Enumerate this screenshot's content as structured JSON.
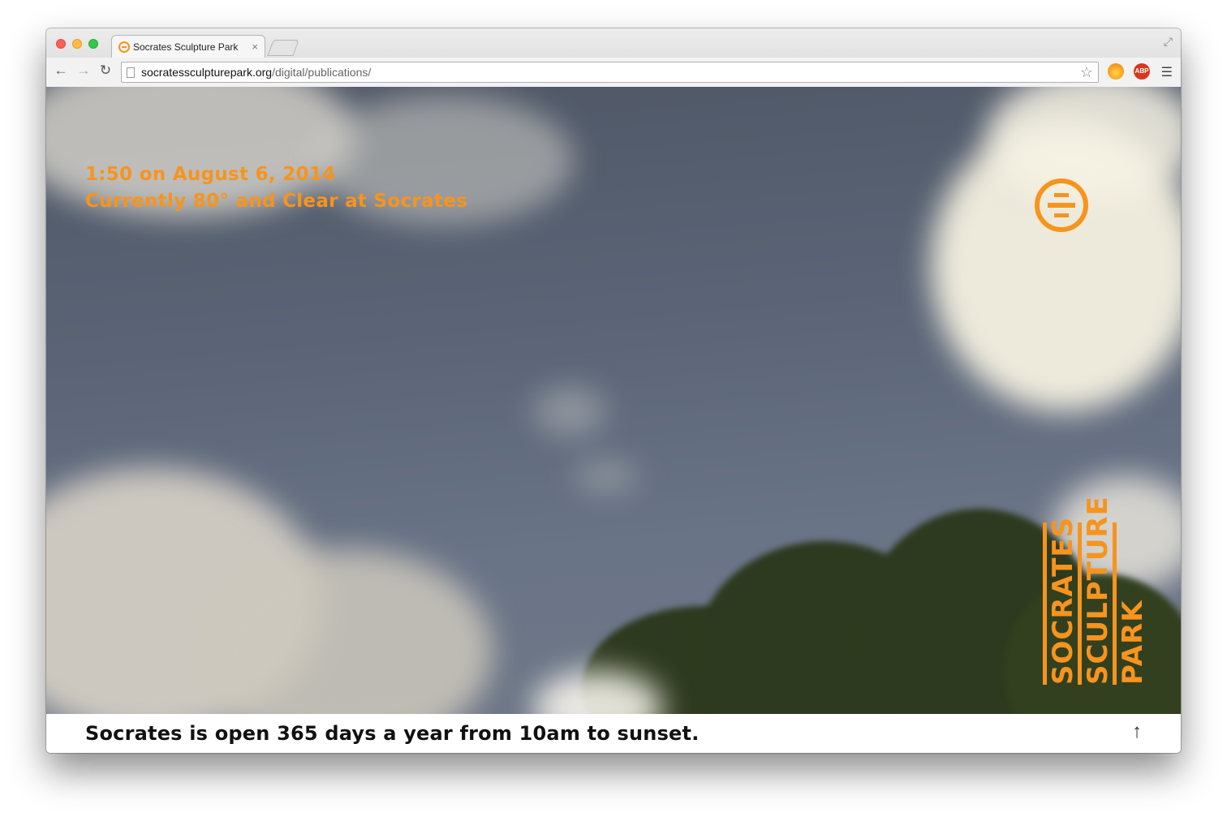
{
  "browser": {
    "tab_title": "Socrates Sculpture Park",
    "tab_close": "×",
    "url_host": "socratessculpturepark.org",
    "url_path": "/digital/publications/",
    "abp_label": "ABP"
  },
  "hero": {
    "time_line": "1:50 on August 6, 2014",
    "weather_line": "Currently 80° and Clear at Socrates",
    "wordmark": [
      "SOCRATES",
      "SCULPTURE",
      "PARK"
    ]
  },
  "footer": {
    "hours_text": "Socrates is open 365 days a year from 10am to sunset.",
    "scroll_top_label": "↑"
  },
  "colors": {
    "accent": "#f7941d"
  }
}
